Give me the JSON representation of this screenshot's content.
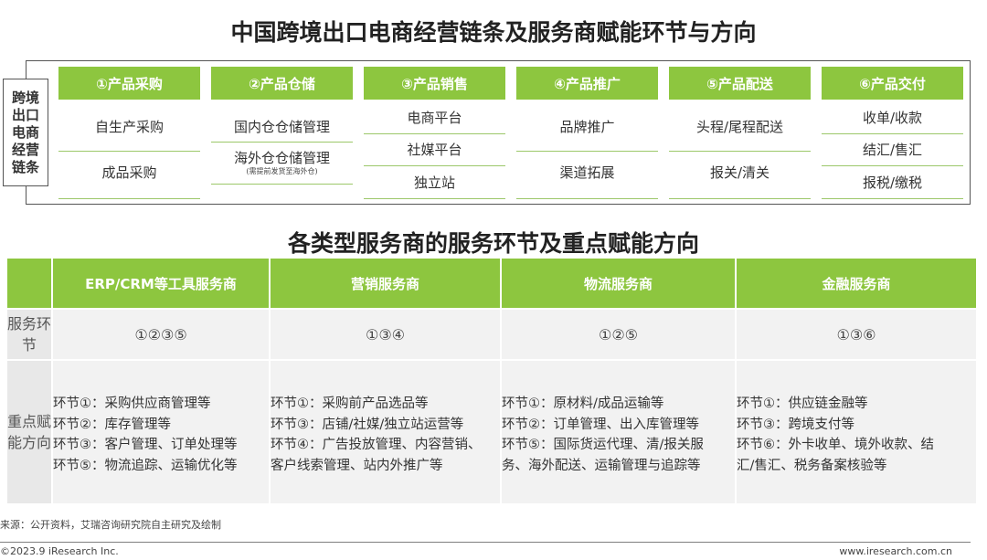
{
  "title": "中国跨境出口电商经营链条及服务商赋能环节与方向",
  "chain_label": "跨境出口电商经营链条",
  "stages": [
    {
      "header": "①产品采购",
      "items": [
        "自生产采购",
        "成品采购"
      ]
    },
    {
      "header": "②产品仓储",
      "items": [
        "国内仓仓储管理",
        "海外仓仓储管理"
      ],
      "note": "(需提前发货至海外仓)"
    },
    {
      "header": "③产品销售",
      "items": [
        "电商平台",
        "社媒平台",
        "独立站"
      ]
    },
    {
      "header": "④产品推广",
      "items": [
        "品牌推广",
        "渠道拓展"
      ]
    },
    {
      "header": "⑤产品配送",
      "items": [
        "头程/尾程配送",
        "报关/清关"
      ]
    },
    {
      "header": "⑥产品交付",
      "items": [
        "收单/收款",
        "结汇/售汇",
        "报税/缴税"
      ]
    }
  ],
  "title2": "各类型服务商的服务环节及重点赋能方向",
  "table": {
    "row_labels": [
      "服务环节",
      "重点赋能方向"
    ],
    "columns": [
      {
        "header": "ERP/CRM等工具服务商",
        "steps": "①②③⑤",
        "lines": [
          "环节①：采购供应商管理等",
          "环节②：库存管理等",
          "环节③：客户管理、订单处理等",
          "环节⑤：物流追踪、运输优化等"
        ]
      },
      {
        "header": "营销服务商",
        "steps": "①③④",
        "lines": [
          "环节①：采购前产品选品等",
          "环节③：店铺/社媒/独立站运营等",
          "环节④：广告投放管理、内容营销、",
          "客户线索管理、站内外推广等"
        ]
      },
      {
        "header": "物流服务商",
        "steps": "①②⑤",
        "lines": [
          "环节①：原材料/成品运输等",
          "环节②：订单管理、出入库管理等",
          "环节⑤：国际货运代理、清/报关服",
          "务、海外配送、运输管理与追踪等"
        ]
      },
      {
        "header": "金融服务商",
        "steps": "①③⑥",
        "lines": [
          "环节①：供应链金融等",
          "环节③：跨境支付等",
          "环节⑥：外卡收单、境外收款、结",
          "汇/售汇、税务备案核验等"
        ]
      }
    ]
  },
  "source": "来源：公开资料，艾瑞咨询研究院自主研究及绘制",
  "copyright": "©2023.9 iResearch Inc.",
  "website": "www.iresearch.com.cn"
}
